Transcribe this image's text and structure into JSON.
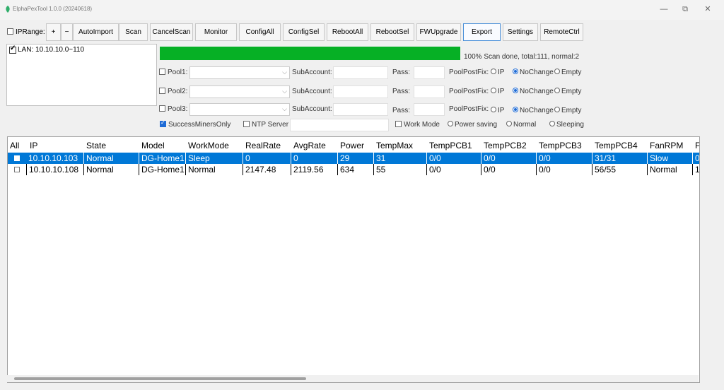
{
  "window": {
    "title": "ElphaPexTool 1.0.0 (20240618)",
    "controls": [
      "—",
      "⧉",
      "✕"
    ]
  },
  "toolbar": {
    "iprange_label": "IPRange:",
    "plus": "+",
    "minus": "−",
    "buttons": [
      "AutoImport",
      "Scan",
      "CancelScan",
      "Monitor",
      "ConfigAll",
      "ConfigSel",
      "RebootAll",
      "RebootSel",
      "FWUpgrade",
      "Export",
      "Settings",
      "RemoteCtrl"
    ]
  },
  "tree": {
    "item": "LAN: 10.10.10.0~110"
  },
  "progress": {
    "percent": 100,
    "status": "100% Scan done, total:111, normal:2",
    "color": "#06b025"
  },
  "pools": [
    {
      "label": "Pool1:",
      "sub_label": "SubAccount:",
      "pass_label": "Pass:",
      "postfix_label": "PoolPostFix:",
      "options": [
        "IP",
        "NoChange",
        "Empty"
      ],
      "selected": "NoChange"
    },
    {
      "label": "Pool2:",
      "sub_label": "SubAccount:",
      "pass_label": "Pass:",
      "postfix_label": "PoolPostFix:",
      "options": [
        "IP",
        "NoChange",
        "Empty"
      ],
      "selected": "NoChange"
    },
    {
      "label": "Pool3:",
      "sub_label": "SubAccount:",
      "pass_label": "Pass:",
      "postfix_label": "PoolPostFix:",
      "options": [
        "IP",
        "NoChange",
        "Empty"
      ],
      "selected": "NoChange"
    }
  ],
  "options": {
    "success_only": "SuccessMinersOnly",
    "ntp_server": "NTP Server",
    "work_mode": "Work Mode",
    "power_saving": "Power saving",
    "normal": "Normal",
    "sleeping": "Sleeping"
  },
  "table": {
    "columns": [
      "All",
      "IP",
      "State",
      "Model",
      "WorkMode",
      "RealRate",
      "AvgRate",
      "Power",
      "TempMax",
      "TempPCB1",
      "TempPCB2",
      "TempPCB3",
      "TempPCB4",
      "FanRPM",
      "F"
    ],
    "rows": [
      [
        "",
        "10.10.10.103",
        "Normal",
        "DG-Home1",
        "Sleep",
        "0",
        "0",
        "29",
        "31",
        "0/0",
        "0/0",
        "0/0",
        "31/31",
        "Slow",
        "0"
      ],
      [
        "",
        "10.10.10.108",
        "Normal",
        "DG-Home1",
        "Normal",
        "2147.48",
        "2119.56",
        "634",
        "55",
        "0/0",
        "0/0",
        "0/0",
        "56/55",
        "Normal",
        "1"
      ]
    ],
    "selected_row": 0,
    "selection_color": "#0078d7"
  }
}
